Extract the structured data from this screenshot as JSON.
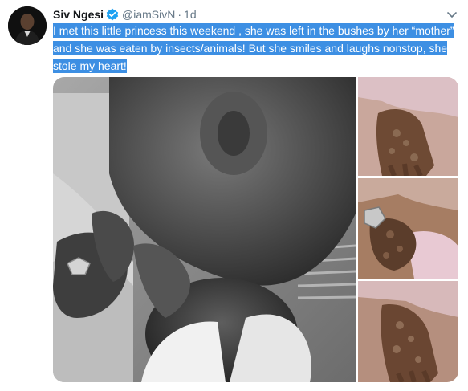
{
  "tweet": {
    "author_name": "Siv Ngesi",
    "handle": "@iamSivN",
    "separator": "·",
    "time": "1d",
    "text": "I met this little princess this weekend , she was left in the bushes by her “mother” and she was eaten by insects/animals! But she smiles and laughs  nonstop, she stole my heart!",
    "verified": true
  },
  "icons": {
    "verified": "verified-badge-icon",
    "menu": "chevron-down-icon"
  },
  "colors": {
    "selection": "#3d8fe3",
    "verified_badge": "#1da1f2",
    "muted_text": "#657786",
    "name_text": "#14171a"
  }
}
